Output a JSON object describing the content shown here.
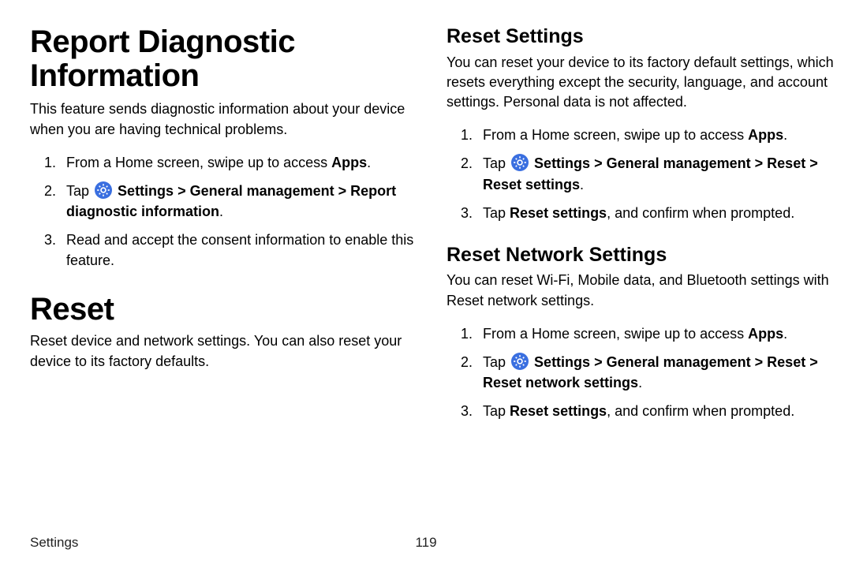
{
  "left": {
    "h1": "Report Diagnostic Information",
    "intro": "This feature sends diagnostic information about your device when you are having technical problems.",
    "steps": {
      "s1_pre": "From a Home screen, swipe up to access ",
      "s1_bold": "Apps",
      "s1_post": ".",
      "s2_pre": "Tap ",
      "s2_settings": "Settings",
      "s2_sep1": " > ",
      "s2_gm": "General management",
      "s2_sep2": " > ",
      "s2_target": "Report diagnostic information",
      "s2_post": ".",
      "s3": "Read and accept the consent information to enable this feature."
    },
    "h1b": "Reset",
    "introb": "Reset device and network settings. You can also reset your device to its factory defaults."
  },
  "right": {
    "rs_h2": "Reset Settings",
    "rs_intro": "You can reset your device to its factory default settings, which resets everything except the security, language, and account settings. Personal data is not affected.",
    "rs": {
      "s1_pre": "From a Home screen, swipe up to access ",
      "s1_bold": "Apps",
      "s1_post": ".",
      "s2_pre": "Tap ",
      "s2_settings": "Settings",
      "s2_sep1": " > ",
      "s2_gm": "General management",
      "s2_sep2": " > ",
      "s2_reset": "Reset",
      "s2_sep3": " > ",
      "s2_target": "Reset settings",
      "s2_post": ".",
      "s3_pre": "Tap ",
      "s3_bold": "Reset settings",
      "s3_post": ", and confirm when prompted."
    },
    "rns_h2": "Reset Network Settings",
    "rns_intro": "You can reset Wi-Fi, Mobile data, and Bluetooth settings with Reset network settings.",
    "rns": {
      "s1_pre": "From a Home screen, swipe up to access ",
      "s1_bold": "Apps",
      "s1_post": ".",
      "s2_pre": "Tap ",
      "s2_settings": "Settings",
      "s2_sep1": " > ",
      "s2_gm": "General management",
      "s2_sep2": " > ",
      "s2_reset": "Reset",
      "s2_sep3": " > ",
      "s2_target": "Reset network settings",
      "s2_post": ".",
      "s3_pre": "Tap ",
      "s3_bold": "Reset settings",
      "s3_post": ", and confirm when prompted."
    }
  },
  "footer": {
    "section": "Settings",
    "page": "119"
  },
  "icons": {
    "settings_color": "#3a6fe0"
  }
}
